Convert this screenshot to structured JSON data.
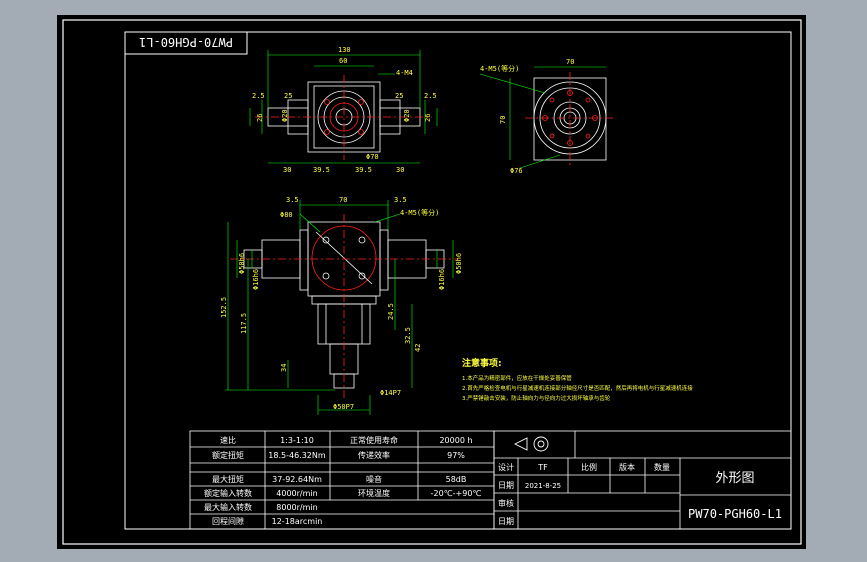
{
  "drawing": {
    "title_rotated": "PW70-PGH60-L1",
    "top_view": {
      "dim_130": "130",
      "dim_60": "60",
      "dim_4m4": "4-M4",
      "dim_25_left": "25",
      "dim_25_right": "25",
      "dim_26_left": "26",
      "dim_26_right": "26",
      "dim_phi20_left": "Φ20",
      "dim_phi20_right": "Φ20",
      "dim_phi70": "Φ70",
      "dim_30_left": "30",
      "dim_39_5_left": "39.5",
      "dim_39_5_right": "39.5",
      "dim_30_right": "30",
      "dim_2_5_left": "2.5",
      "dim_2_5_right": "2.5"
    },
    "right_view": {
      "dim_4m5": "4-M5(等分)",
      "dim_70_top": "70",
      "dim_70_left": "70",
      "dim_phi76": "Φ76"
    },
    "front_view": {
      "dim_3_5_left": "3.5",
      "dim_70": "70",
      "dim_3_5_right": "3.5",
      "dim_phi80": "Φ80",
      "dim_4m5": "4-M5(等分)",
      "dim_phi50_left": "Φ50h6",
      "dim_phi16_left": "Φ16h6",
      "dim_phi50_right": "Φ50h6",
      "dim_phi16_right": "Φ16h6",
      "dim_152_5": "152.5",
      "dim_117_5": "117.5",
      "dim_34": "34",
      "dim_24_5": "24.5",
      "dim_32_5": "32.5",
      "dim_42": "42",
      "dim_phi14": "Φ14P7",
      "dim_phi50_bottom": "Φ50P7"
    },
    "notes": {
      "title": "注意事项:",
      "lines": [
        "1.本产品为精密部件，应放在干燥处妥善保管",
        "2.首先严格检查电机与行星减速机连接部分轴径尺寸是否匹配，然后再将电机与行星减速机连接",
        "3.严禁锤敲击安装，防止轴向力与径向力过大损坏轴承与齿轮"
      ]
    }
  },
  "spec_table": {
    "rows": [
      [
        "速比",
        "1:3-1:10",
        "正常使用寿命",
        "20000 h"
      ],
      [
        "额定扭矩",
        "18.5-46.32Nm",
        "传递效率",
        "97%"
      ],
      [
        "最大扭矩",
        "37-92.64Nm",
        "噪音",
        "58dB"
      ],
      [
        "额定输入转数",
        "4000r/min",
        "环境温度",
        "-20℃-+90℃"
      ],
      [
        "最大输入转数",
        "8000r/min",
        "",
        ""
      ],
      [
        "回程间隙",
        "12-18arcmin",
        "",
        ""
      ]
    ]
  },
  "title_block": {
    "headers": [
      "设计",
      "TF",
      "比例",
      "版本",
      "数量"
    ],
    "date_label": "日期",
    "date_value": "2021-8-25",
    "review_label": "审核",
    "date2_label": "日期",
    "drawing_name": "外形图",
    "drawing_number": "PW70-PGH60-L1"
  },
  "colors": {
    "line": "#ffffff",
    "dim": "#00ff00",
    "red": "#ff2020",
    "cyan": "#00e0e0",
    "yellow": "#ffff40",
    "border": "#ffffff"
  }
}
